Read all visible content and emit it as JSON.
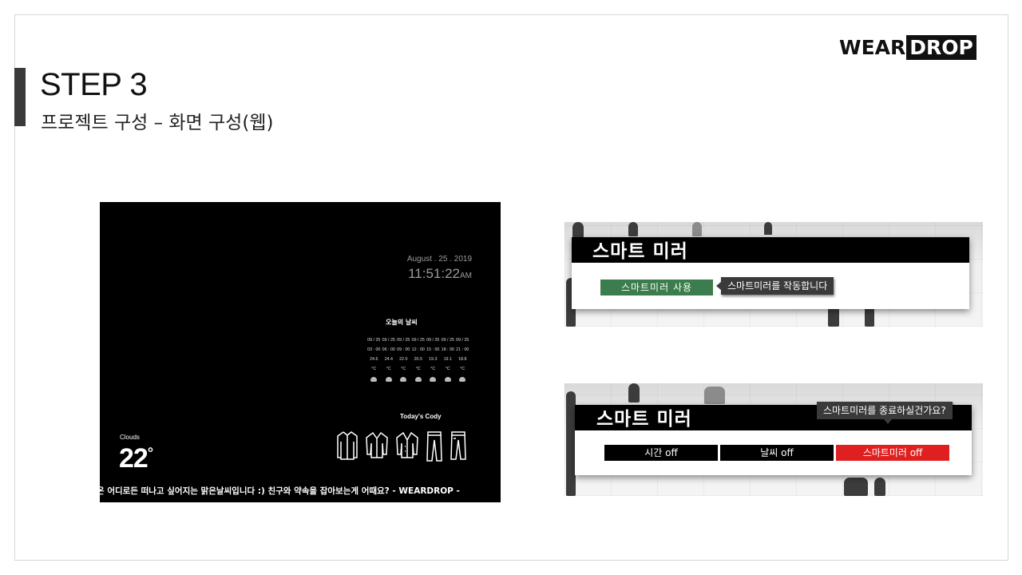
{
  "brand": {
    "logo_left": "WEAR",
    "logo_right": "DROP"
  },
  "header": {
    "title": "STEP 3",
    "subtitle": "프로젝트 구성 – 화면 구성(웹)"
  },
  "mirror": {
    "date": "August . 25 . 2019",
    "time": "11:51:22",
    "time_suffix": "AM",
    "weather_title": "오늘의 날씨",
    "forecast": [
      {
        "date": "09 / 25",
        "time": "03 : 00",
        "temp": "24.6 °C"
      },
      {
        "date": "09 / 25",
        "time": "06 : 00",
        "temp": "24.4 °C"
      },
      {
        "date": "09 / 25",
        "time": "09 : 00",
        "temp": "22.0 °C"
      },
      {
        "date": "09 / 25",
        "time": "12 : 00",
        "temp": "20.5 °C"
      },
      {
        "date": "09 / 25",
        "time": "15 : 00",
        "temp": "19.3 °C"
      },
      {
        "date": "09 / 25",
        "time": "18 : 00",
        "temp": "19.1 °C"
      },
      {
        "date": "09 / 25",
        "time": "21 : 00",
        "temp": "18.8 °C"
      }
    ],
    "forecast_icon": "cloud-icon",
    "cody_title": "Today's Cody",
    "clothes_icons": [
      "shirt-icon",
      "jacket-icon",
      "cardigan-icon",
      "pants-icon",
      "jeans-icon"
    ],
    "condition": "Clouds",
    "temperature": "22",
    "temperature_unit": "°",
    "ticker": "온 어디로든 떠나고 싶어지는 맑은날씨입니다 :) 친구와 약속을 잡아보는게 어때요? - WEARDROP -"
  },
  "panel_start": {
    "header": "스마트 미러",
    "button": "스마트미러 사용",
    "tooltip": "스마트미러를 작동합니다"
  },
  "panel_stop": {
    "header": "스마트 미러",
    "buttons": [
      "시간 off",
      "날씨 off",
      "스마트미러 off"
    ],
    "tooltip": "스마트미러를 종료하실건가요?"
  },
  "colors": {
    "accent_green": "#3b7d4c",
    "accent_red": "#e02020",
    "dark": "#000000"
  }
}
